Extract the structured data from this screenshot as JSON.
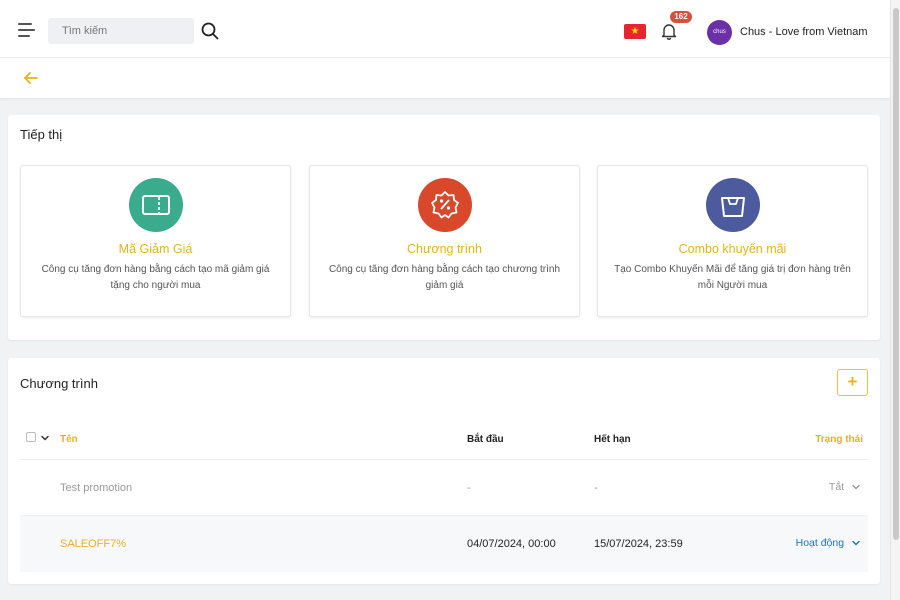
{
  "header": {
    "search_placeholder": "Tìm kiếm",
    "notification_count": "162",
    "avatar_text": "chus",
    "flag_symbol": "★",
    "username": "Chus - Love from Vietnam"
  },
  "marketing": {
    "title": "Tiếp thị",
    "tools": [
      {
        "title": "Mã Giảm Giá",
        "description": "Công cụ tăng đơn hàng bằng cách tạo mã giảm giá tặng cho người mua",
        "icon": "ticket-icon",
        "color": "#3bab8e"
      },
      {
        "title": "Chương trình",
        "description": "Công cụ tăng đơn hàng bằng cách tạo chương trình giảm giá",
        "icon": "percent-badge-icon",
        "color": "#d9482b"
      },
      {
        "title": "Combo khuyến mãi",
        "description": "Tạo Combo Khuyến Mãi để tăng giá trị đơn hàng trên mỗi Người mua",
        "icon": "shopping-bag-icon",
        "color": "#4c5a9e"
      }
    ]
  },
  "programs": {
    "title": "Chương trình",
    "add_label": "+",
    "columns": {
      "name": "Tên",
      "start": "Bắt đầu",
      "end": "Hết hạn",
      "status": "Trạng thái"
    },
    "rows": [
      {
        "name": "Test promotion",
        "start": "-",
        "end": "-",
        "status": "Tắt"
      },
      {
        "name": "SALEOFF7%",
        "start": "04/07/2024, 00:00",
        "end": "15/07/2024, 23:59",
        "status": "Hoạt động"
      }
    ]
  },
  "colors": {
    "accent": "#e8b21c",
    "active_status": "#1a73c8",
    "inactive_text": "#999999",
    "badge": "#d84f3f"
  }
}
